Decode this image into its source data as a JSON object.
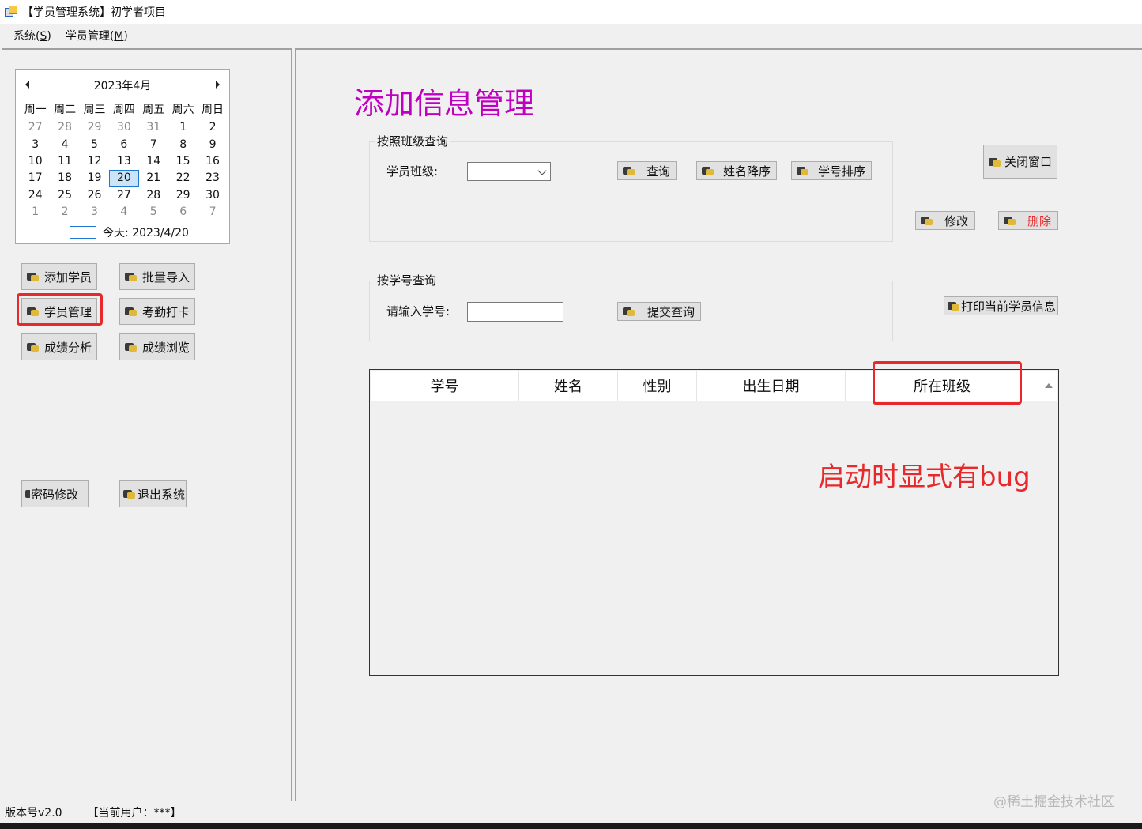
{
  "window": {
    "title": "【学员管理系统】初学者项目",
    "icon": "app-window-icon"
  },
  "menu": [
    {
      "label": "系统(",
      "key": "S",
      "suffix": ")"
    },
    {
      "label": "学员管理(",
      "key": "M",
      "suffix": ")"
    }
  ],
  "calendar": {
    "month_label": "2023年4月",
    "weekdays": [
      "周一",
      "周二",
      "周三",
      "周四",
      "周五",
      "周六",
      "周日"
    ],
    "weeks": [
      [
        "27",
        "28",
        "29",
        "30",
        "31",
        "1",
        "2"
      ],
      [
        "3",
        "4",
        "5",
        "6",
        "7",
        "8",
        "9"
      ],
      [
        "10",
        "11",
        "12",
        "13",
        "14",
        "15",
        "16"
      ],
      [
        "17",
        "18",
        "19",
        "20",
        "21",
        "22",
        "23"
      ],
      [
        "24",
        "25",
        "26",
        "27",
        "28",
        "29",
        "30"
      ],
      [
        "1",
        "2",
        "3",
        "4",
        "5",
        "6",
        "7"
      ]
    ],
    "dim_cells": [
      [
        0,
        0
      ],
      [
        0,
        1
      ],
      [
        0,
        2
      ],
      [
        0,
        3
      ],
      [
        0,
        4
      ],
      [
        5,
        0
      ],
      [
        5,
        1
      ],
      [
        5,
        2
      ],
      [
        5,
        3
      ],
      [
        5,
        4
      ],
      [
        5,
        5
      ],
      [
        5,
        6
      ]
    ],
    "selected": "20",
    "today_label": "今天: 2023/4/20"
  },
  "left_buttons": {
    "add_student": "添加学员",
    "batch_import": "批量导入",
    "student_manage": "学员管理",
    "attendance": "考勤打卡",
    "score_analysis": "成绩分析",
    "score_browse": "成绩浏览",
    "change_password": "密码修改",
    "exit_system": "退出系统"
  },
  "main": {
    "heading": "添加信息管理",
    "class_group": {
      "title": "按照班级查询",
      "class_label": "学员班级:",
      "class_value": "",
      "query": "查询",
      "name_desc": "姓名降序",
      "id_sort": "学号排序"
    },
    "id_group": {
      "title": "按学号查询",
      "id_label": "请输入学号:",
      "id_value": "",
      "submit": "提交查询"
    },
    "close_window": "关闭窗口",
    "edit": "修改",
    "delete": "删除",
    "print_current": "打印当前学员信息",
    "table": {
      "columns": [
        "学号",
        "姓名",
        "性别",
        "出生日期",
        "所在班级"
      ],
      "rows": []
    },
    "annotation": "启动时显式有bug"
  },
  "status": {
    "version": "版本号v2.0",
    "current_user": "【当前用户：***】"
  },
  "watermark": "@稀土掘金技术社区",
  "colors": {
    "heading": "#c000c0",
    "annotation": "#e8282a",
    "delete_text": "#e8282a",
    "highlight_box": "#e8282a"
  }
}
